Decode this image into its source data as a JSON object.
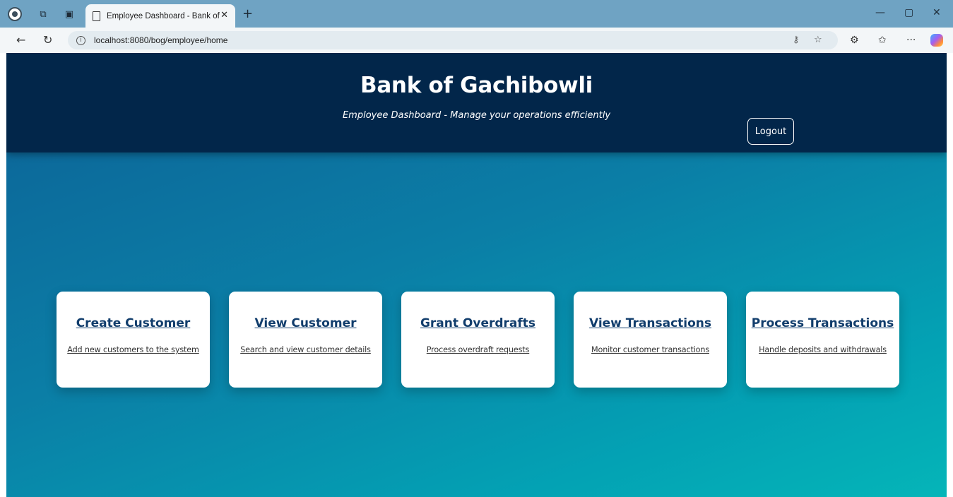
{
  "browser": {
    "tab_title": "Employee Dashboard - Bank of G",
    "tab_close": "✕",
    "new_tab": "+",
    "url": "localhost:8080/bog/employee/home",
    "window_controls": {
      "minimize": "—",
      "restore": "▢",
      "close": "✕"
    },
    "icons": {
      "back": "←",
      "reload": "↻",
      "info": "i",
      "key": "⚷",
      "star": "☆",
      "extensions": "⚙",
      "favorites": "✩",
      "more": "···"
    }
  },
  "header": {
    "title": "Bank of Gachibowli",
    "subtitle": "Employee Dashboard - Manage your operations efficiently",
    "logout_label": "Logout"
  },
  "cards": [
    {
      "title": "Create Customer",
      "description": "Add new customers to the system"
    },
    {
      "title": "View Customer",
      "description": "Search and view customer details"
    },
    {
      "title": "Grant Overdrafts",
      "description": "Process overdraft requests"
    },
    {
      "title": "View Transactions",
      "description": "Monitor customer transactions"
    },
    {
      "title": "Process Transactions",
      "description": "Handle deposits and withdrawals"
    }
  ],
  "colors": {
    "header_bg": "#02264a",
    "card_title": "#113d6c",
    "gradient_start": "#0d6196",
    "gradient_end": "#05b5b8"
  }
}
